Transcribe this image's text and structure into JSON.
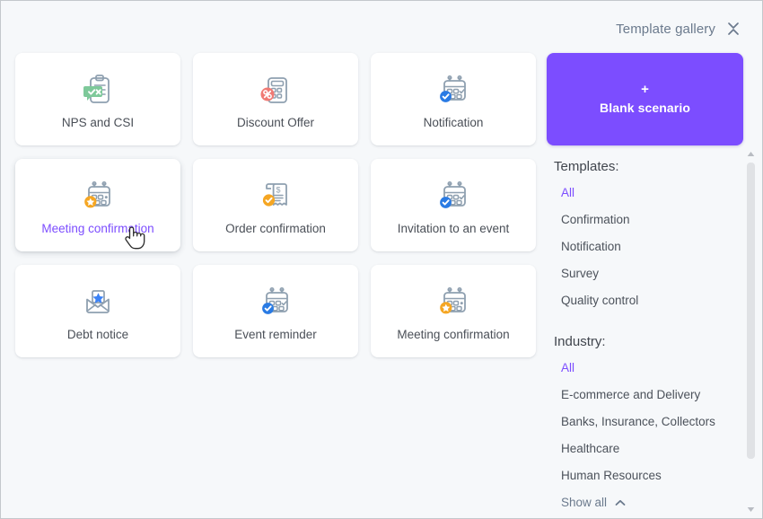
{
  "header": {
    "title": "Template gallery",
    "collapse_icon": "collapse-chevrons-icon"
  },
  "blank_scenario": {
    "plus": "+",
    "label": "Blank scenario",
    "color": "#7c4dff"
  },
  "cards": [
    {
      "label": "NPS and CSI",
      "icon": "clipboard-feedback-icon",
      "badge_color": "#7ec99a"
    },
    {
      "label": "Discount Offer",
      "icon": "calculator-percent-icon",
      "badge_color": "#f07a74"
    },
    {
      "label": "Notification",
      "icon": "calendar-check-icon",
      "badge_color": "#2a7be4"
    },
    {
      "label": "Meeting confirmation",
      "icon": "calendar-star-icon",
      "badge_color": "#f5a623",
      "hovered": true
    },
    {
      "label": "Order confirmation",
      "icon": "receipt-check-icon",
      "badge_color": "#f5a623"
    },
    {
      "label": "Invitation to an event",
      "icon": "calendar-check-icon",
      "badge_color": "#2a7be4"
    },
    {
      "label": "Debt notice",
      "icon": "envelope-star-icon",
      "badge_color": "#3b82f6"
    },
    {
      "label": "Event reminder",
      "icon": "calendar-check-icon",
      "badge_color": "#2a7be4"
    },
    {
      "label": "Meeting confirmation",
      "icon": "calendar-star-icon",
      "badge_color": "#f5a623"
    }
  ],
  "filters": {
    "templates": {
      "heading": "Templates:",
      "items": [
        {
          "label": "All",
          "active": true
        },
        {
          "label": "Confirmation",
          "active": false
        },
        {
          "label": "Notification",
          "active": false
        },
        {
          "label": "Survey",
          "active": false
        },
        {
          "label": "Quality control",
          "active": false
        }
      ]
    },
    "industry": {
      "heading": "Industry:",
      "items": [
        {
          "label": "All",
          "active": true
        },
        {
          "label": "E-commerce and Delivery",
          "active": false
        },
        {
          "label": "Banks, Insurance, Collectors",
          "active": false
        },
        {
          "label": "Healthcare",
          "active": false
        },
        {
          "label": "Human Resources",
          "active": false
        }
      ],
      "show_all": "Show all"
    }
  }
}
